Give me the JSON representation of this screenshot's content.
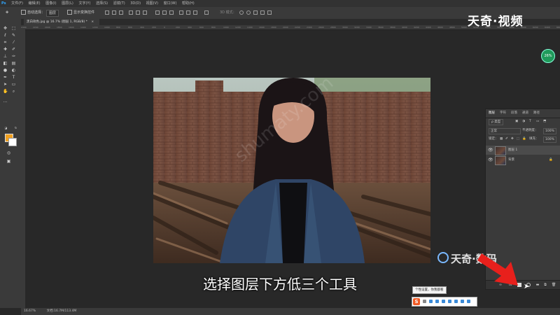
{
  "menu": {
    "logo": "Ps",
    "items": [
      "文件(F)",
      "编辑(E)",
      "图像(I)",
      "图层(L)",
      "文字(Y)",
      "选择(S)",
      "滤镜(T)",
      "3D(D)",
      "视图(V)",
      "窗口(W)",
      "帮助(H)"
    ]
  },
  "options": {
    "auto_select_label": "自动选择：",
    "auto_select_target": "图层",
    "show_transform_label": "显示变换控件",
    "mode_3d": "3D 模式："
  },
  "tab": {
    "title": "黑白效色.jpg @ 16.7% (图层 1, RGB/8) *",
    "close": "×"
  },
  "ruler": {
    "ticks": [
      "2400",
      "2200",
      "2000",
      "1800",
      "1600",
      "1400",
      "1200",
      "1000",
      "800",
      "600",
      "400",
      "200",
      "0",
      "200",
      "400",
      "600",
      "800",
      "1000",
      "1200",
      "1400",
      "1600",
      "1800",
      "2000",
      "2200",
      "2400",
      "2600",
      "2800",
      "3000",
      "3200",
      "3400",
      "3600",
      "3800",
      "4000",
      "4200",
      "4400",
      "4600",
      "4800",
      "5000",
      "5200",
      "5400",
      "5600",
      "5800",
      "6000",
      "6200",
      "6400",
      "6600"
    ]
  },
  "layers_panel": {
    "tabs": [
      "图层",
      "字符",
      "段落",
      "通道",
      "路径"
    ],
    "filter_label": "ρ 类型",
    "blend_mode": "正常",
    "opacity_label": "不透明度：",
    "opacity_value": "100%",
    "lock_label": "锁定：",
    "fill_label": "填充：",
    "fill_value": "100%",
    "layers": [
      {
        "name": "图层 1",
        "selected": true
      },
      {
        "name": "背景",
        "selected": false
      }
    ]
  },
  "status": {
    "zoom": "16.67%",
    "doc": "文档:16.7M/113.4M"
  },
  "overlay": {
    "brand": "天奇·视频",
    "watermark": "天奇·数码",
    "caption": "选择图层下方低三个工具",
    "photo_watermark": "shumaty.com",
    "zoom_badge": "26%",
    "tooltip": "个性设置，你我都看"
  },
  "colors": {
    "foreground": "#f0a020",
    "background": "#ffffff",
    "accent": "#31a8ff"
  }
}
